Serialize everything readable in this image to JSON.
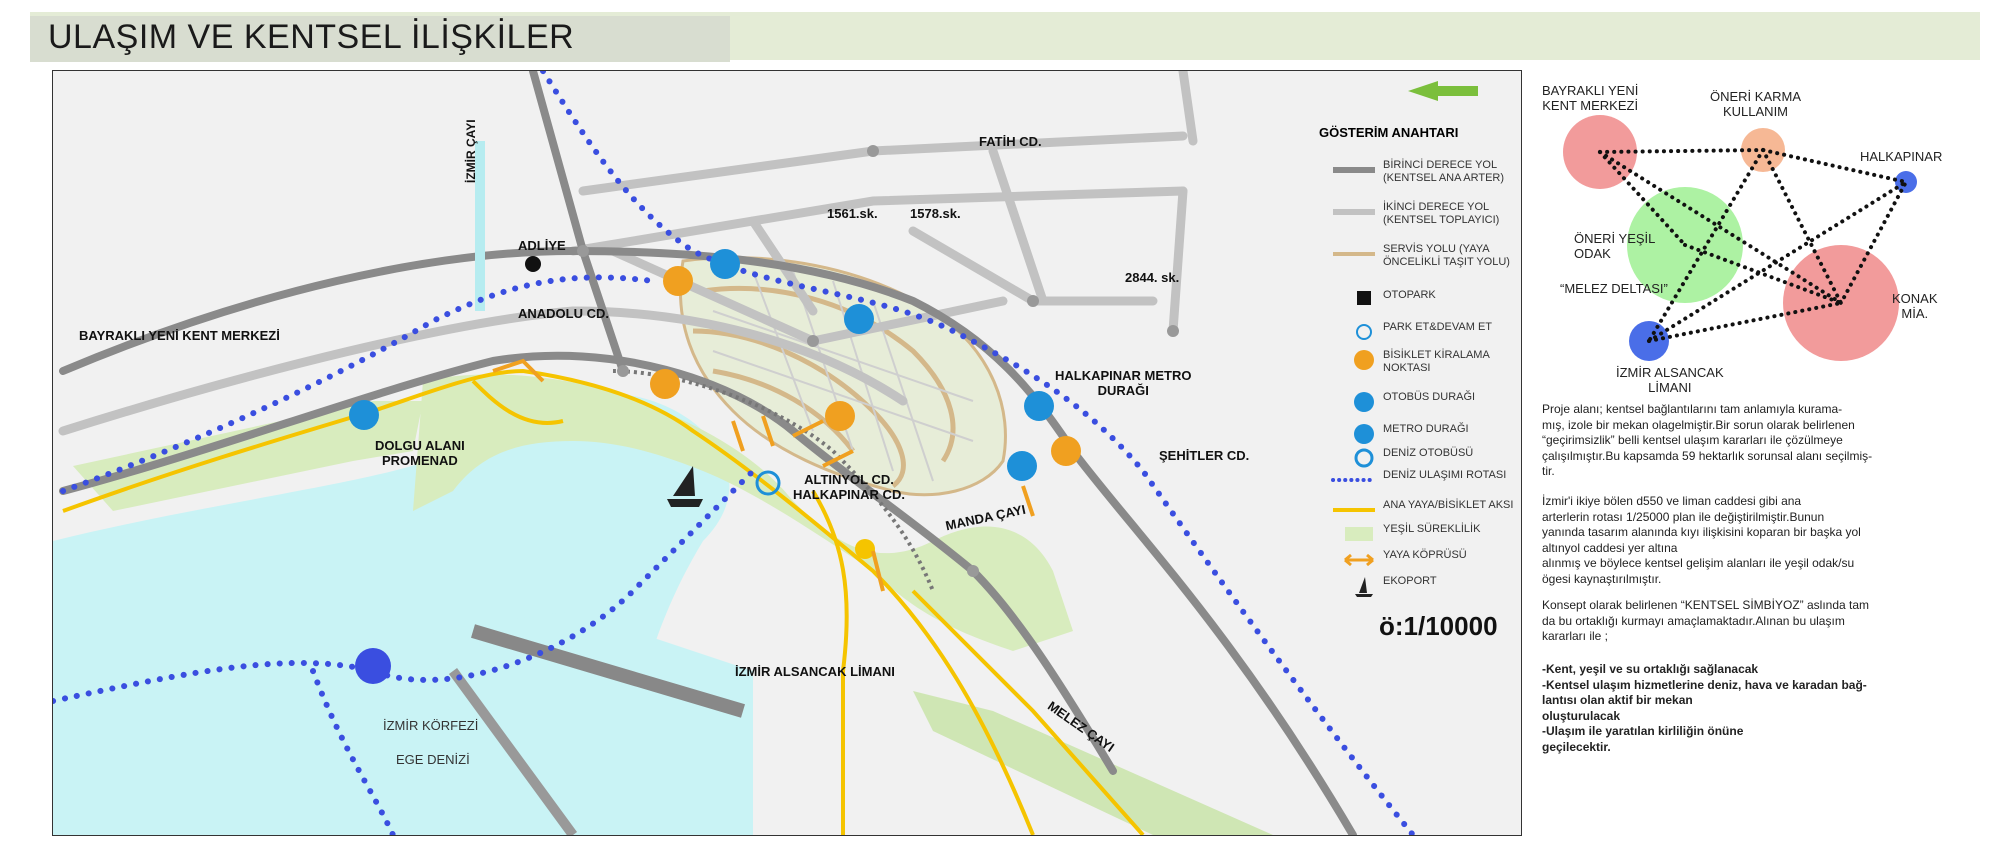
{
  "title": "ULAŞIM VE KENTSEL İLİŞKİLER",
  "map_labels": {
    "bayrakli": "BAYRAKLI YENİ KENT MERKEZİ",
    "adliye": "ADLİYE",
    "anadolu": "ANADOLU CD.",
    "izmir_cayi": "İZMİR ÇAYI",
    "fatih": "FATİH CD.",
    "s1561": "1561.sk.",
    "s1578": "1578.sk.",
    "s2844": "2844. sk.",
    "halkapinar_metro": "HALKAPINAR METRO\nDURAĞI",
    "sehitler": "ŞEHİTLER CD.",
    "dolgu": "DOLGU ALANI\nPROMENAD",
    "altinyol": "ALTINYOL CD.\nHALKAPINAR CD.",
    "manda": "MANDA ÇAYI",
    "alsancak_limani": "İZMİR ALSANCAK LİMANI",
    "melez": "MELEZ ÇAYI",
    "korfez": "İZMİR KÖRFEZİ",
    "ege": "EGE DENİZİ"
  },
  "legend": {
    "title": "GÖSTERİM ANAHTARI",
    "items": [
      {
        "label": "BİRİNCİ DERECE YOL\n(KENTSEL ANA ARTER)",
        "icon": "primary-road"
      },
      {
        "label": "İKİNCİ DERECE YOL\n(KENTSEL TOPLAYICI)",
        "icon": "secondary-road"
      },
      {
        "label": "SERVİS YOLU (YAYA\nÖNCELİKLİ TAŞIT YOLU)",
        "icon": "service-road"
      },
      {
        "label": "OTOPARK",
        "icon": "parking-icon"
      },
      {
        "label": "PARK ET&DEVAM ET",
        "icon": "park-ride-icon"
      },
      {
        "label": "BİSİKLET KİRALAMA\nNOKTASI",
        "icon": "bicycle-icon"
      },
      {
        "label": "OTOBÜS DURAĞI",
        "icon": "bus-icon"
      },
      {
        "label": "METRO DURAĞI",
        "icon": "metro-icon"
      },
      {
        "label": "DENİZ OTOBÜSÜ",
        "icon": "ship-wheel-icon"
      },
      {
        "label": "DENİZ ULAŞIMI ROTASI",
        "icon": "sea-route"
      },
      {
        "label": "ANA YAYA/BİSİKLET AKSI",
        "icon": "pedestrian-axis"
      },
      {
        "label": "YEŞİL SÜREKLİLİK",
        "icon": "green-continuity"
      },
      {
        "label": "YAYA KÖPRÜSÜ",
        "icon": "footbridge-icon"
      },
      {
        "label": "EKOPORT",
        "icon": "sailboat-icon"
      }
    ]
  },
  "scale": "ö:1/10000",
  "diagram": {
    "nodes": {
      "bayrakli": "BAYRAKLI YENİ\nKENT MERKEZİ",
      "karma": "ÖNERİ KARMA\nKULLANIM",
      "halkapinar": "HALKAPINAR",
      "yesil": "ÖNERİ YEŞİL\nODAK",
      "melez": "“MELEZ DELTASI”",
      "konak": "KONAK\nMİA.",
      "alsancak": "İZMİR ALSANCAK\nLİMANI"
    }
  },
  "description": {
    "p1": "Proje alanı; kentsel bağlantılarını tam anlamıyla kurama-\nmış, izole bir mekan olagelmiştir.Bir sorun olarak belirlenen\n“geçirimsizlik” belli kentsel ulaşım kararları ile çözülmeye\nçalışılmıştır.Bu kapsamda 59 hektarlık sorunsal alanı seçilmiş-\ntir.",
    "p2": "İzmir'i ikiye bölen d550 ve liman caddesi gibi ana\narterlerin rotası 1/25000 plan ile değiştirilmiştir.Bunun\nyanında tasarım alanında kıyı ilişkisini koparan bir başka yol\naltınyol caddesi yer altına\nalınmış ve böylece kentsel gelişim alanları ile yeşil odak/su\nögesi kaynaştırılmıştır.",
    "p3": "Konsept olarak belirlenen “KENTSEL SİMBİYOZ” aslında tam\nda bu ortaklığı kurmayı amaçlamaktadır.Alınan bu ulaşım\nkararları ile ;",
    "p4": "-Kent, yeşil ve su ortaklığı sağlanacak\n-Kentsel ulaşım hizmetlerine deniz, hava ve karadan bağ-\nlantısı olan aktif bir mekan\noluşturulacak\n-Ulaşım ile yaratılan kirliliğin önüne\ngeçilecektir."
  },
  "colors": {
    "sea": "#c9f3f5",
    "green": "#d8ecbe",
    "primary_road": "#8a8a8a",
    "secondary_road": "#c2c2c2",
    "service_road": "#d4b88a",
    "pedestrian": "#f5c400",
    "sea_route": "#3a4ee0",
    "bike": "#f0a020",
    "bus": "#1e90d8"
  }
}
